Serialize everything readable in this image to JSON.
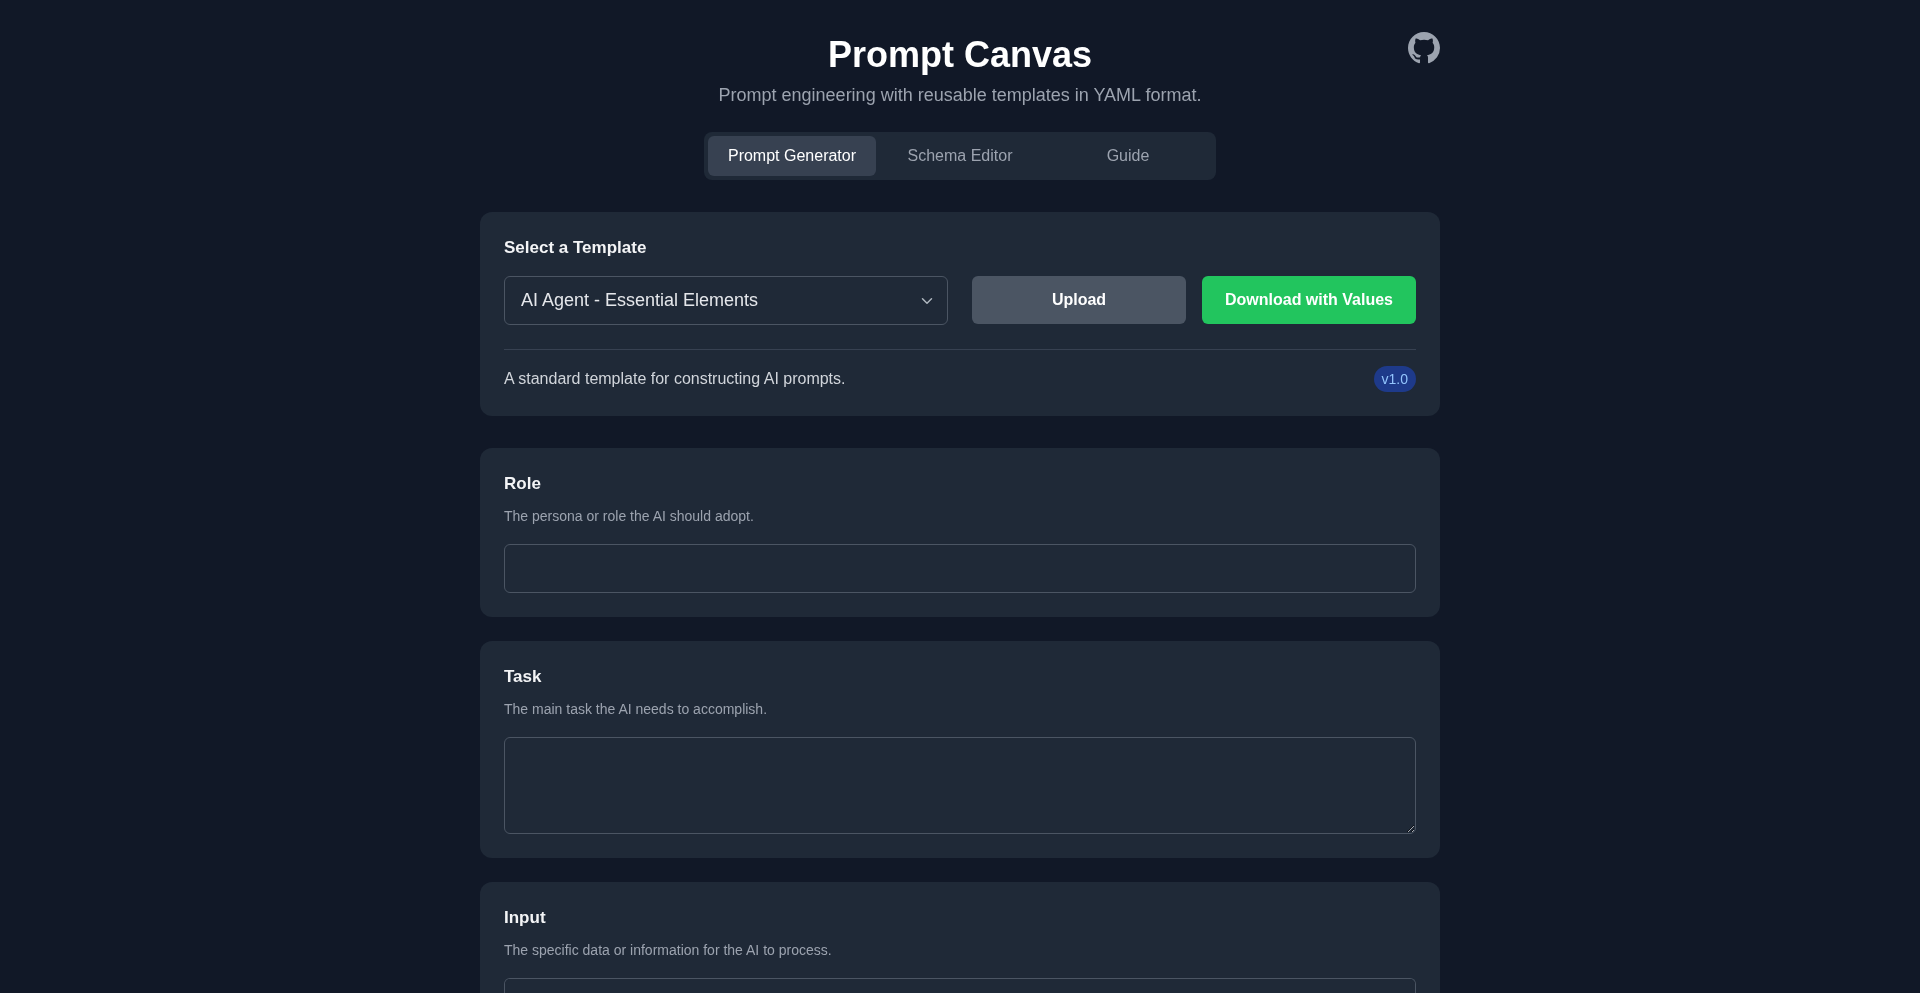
{
  "header": {
    "title": "Prompt Canvas",
    "subtitle": "Prompt engineering with reusable templates in YAML format."
  },
  "tabs": [
    {
      "label": "Prompt Generator",
      "selected": true
    },
    {
      "label": "Schema Editor",
      "selected": false
    },
    {
      "label": "Guide",
      "selected": false
    }
  ],
  "template_card": {
    "heading": "Select a Template",
    "selected_template": "AI Agent - Essential Elements",
    "buttons": [
      {
        "label": "Upload",
        "kind": "secondary"
      },
      {
        "label": "Download with Values",
        "kind": "success"
      }
    ],
    "description": "A standard template for constructing AI prompts.",
    "version": "v1.0"
  },
  "fields": [
    {
      "label": "Role",
      "help": "The persona or role the AI should adopt.",
      "kind": "input"
    },
    {
      "label": "Task",
      "help": "The main task the AI needs to accomplish.",
      "kind": "textarea"
    },
    {
      "label": "Input",
      "help": "The specific data or information for the AI to process.",
      "kind": "textarea"
    }
  ]
}
